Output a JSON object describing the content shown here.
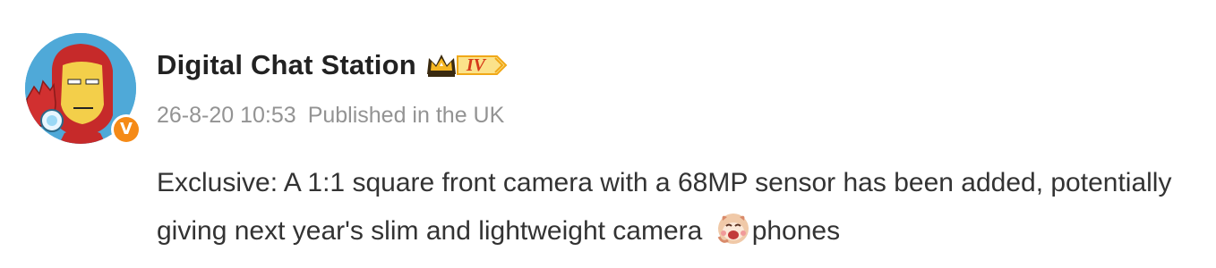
{
  "author": {
    "name": "Digital Chat Station",
    "avatar_icon": "iron-man-avatar-icon",
    "verified_badge": "V",
    "level_badge": "IV",
    "level_icon": "crown-icon"
  },
  "meta": {
    "timestamp": "26-8-20 10:53",
    "location": "Published in the UK"
  },
  "post": {
    "text_before_emoji": "Exclusive: A 1:1 square front camera with a 68MP sensor has been added, potentially giving next year's slim and lightweight camera ",
    "emoji_icon": "laughing-doge-emoji-icon",
    "text_after_emoji": "phones"
  },
  "colors": {
    "verified": "#f58a17",
    "level_badge": "#f5b623",
    "meta_text": "#939393"
  }
}
